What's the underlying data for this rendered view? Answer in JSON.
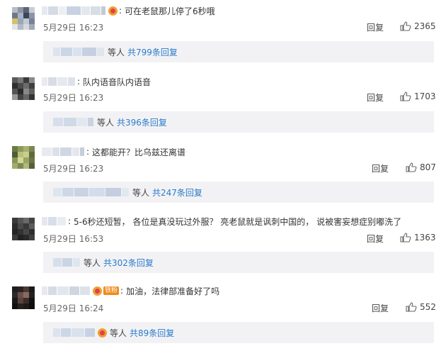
{
  "reply_label": "回复",
  "others_label": "等人",
  "colors": {
    "link": "#2b7bc9",
    "reply_bg": "#f2f2f5",
    "text": "#333333",
    "muted": "#666666"
  },
  "icons": {
    "like": "thumbs-up-icon",
    "vip": "vip-badge-icon"
  },
  "comments": [
    {
      "text": "可在老鼠那儿停了6秒哦",
      "time": "5月29日 16:23",
      "likes": "2365",
      "reply_summary": "共799条回复"
    },
    {
      "text": "队内语音队内语音",
      "time": "5月29日 16:23",
      "likes": "1703",
      "reply_summary": "共396条回复"
    },
    {
      "text": "这都能开？比乌兹还离谱",
      "time": "5月29日 16:23",
      "likes": "807",
      "reply_summary": "共247条回复"
    },
    {
      "text": "5-6秒还短暂， 各位是真没玩过外服？ 亮老鼠就是讽刺中国的， 说被害妄想症别嘟洗了",
      "time": "5月29日 16:53",
      "likes": "1363",
      "reply_summary": "共302条回复"
    },
    {
      "text": "加油，法律部准备好了吗",
      "time": "5月29日 16:24",
      "likes": "552",
      "reply_summary": "共89条回复",
      "fan_badge": "铁粉"
    }
  ]
}
